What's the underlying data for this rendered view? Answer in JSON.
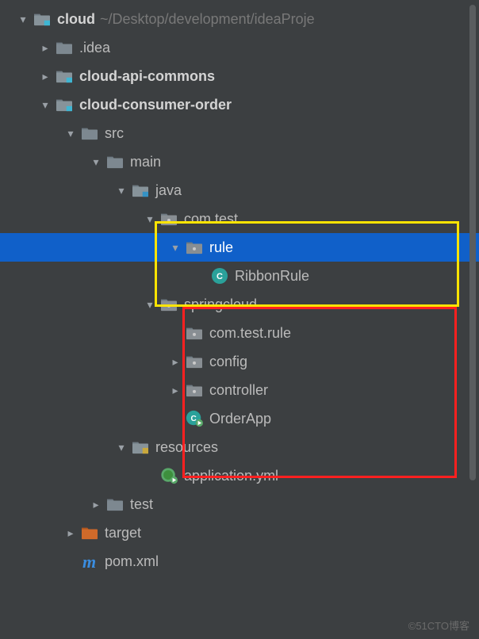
{
  "watermark": "©51CTO博客",
  "tree": [
    {
      "indent": 0,
      "arrow": "down",
      "icon": "module",
      "label": "cloud",
      "bold": true,
      "hint": "~/Desktop/development/ideaProje"
    },
    {
      "indent": 1,
      "arrow": "right",
      "icon": "folder",
      "label": ".idea"
    },
    {
      "indent": 1,
      "arrow": "right",
      "icon": "module",
      "label": "cloud-api-commons",
      "bold": true
    },
    {
      "indent": 1,
      "arrow": "down",
      "icon": "module",
      "label": "cloud-consumer-order",
      "bold": true
    },
    {
      "indent": 2,
      "arrow": "down",
      "icon": "folder",
      "label": "src"
    },
    {
      "indent": 3,
      "arrow": "down",
      "icon": "folder",
      "label": "main"
    },
    {
      "indent": 4,
      "arrow": "down",
      "icon": "source",
      "label": "java"
    },
    {
      "indent": 5,
      "arrow": "down",
      "icon": "package",
      "label": "com.test"
    },
    {
      "indent": 6,
      "arrow": "down",
      "icon": "package",
      "label": "rule",
      "selected": true
    },
    {
      "indent": 7,
      "arrow": "none",
      "icon": "class",
      "label": "RibbonRule"
    },
    {
      "indent": 5,
      "arrow": "down",
      "icon": "package",
      "label": "springcloud"
    },
    {
      "indent": 6,
      "arrow": "none",
      "icon": "package",
      "label": "com.test.rule"
    },
    {
      "indent": 6,
      "arrow": "right",
      "icon": "package",
      "label": "config"
    },
    {
      "indent": 6,
      "arrow": "right",
      "icon": "package",
      "label": "controller"
    },
    {
      "indent": 6,
      "arrow": "none",
      "icon": "class-run",
      "label": "OrderApp"
    },
    {
      "indent": 4,
      "arrow": "down",
      "icon": "resources",
      "label": "resources"
    },
    {
      "indent": 5,
      "arrow": "none",
      "icon": "yml",
      "label": "application.yml"
    },
    {
      "indent": 3,
      "arrow": "right",
      "icon": "folder",
      "label": "test"
    },
    {
      "indent": 2,
      "arrow": "right",
      "icon": "target",
      "label": "target"
    },
    {
      "indent": 2,
      "arrow": "none",
      "icon": "maven",
      "label": "pom.xml"
    }
  ]
}
